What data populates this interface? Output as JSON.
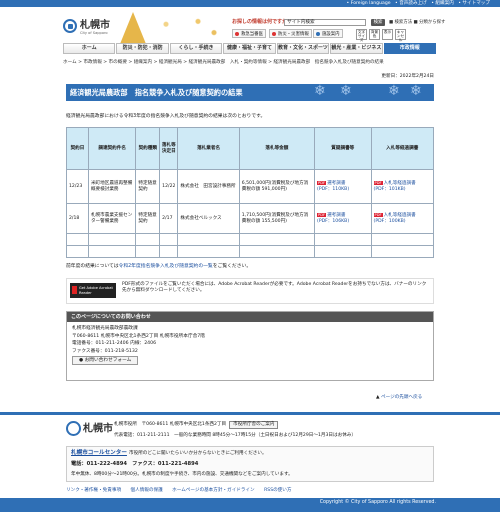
{
  "topbar": {
    "items": [
      "• Foreign language",
      "• 音声読み上げ",
      "• 組織案内",
      "• サイトマップ"
    ]
  },
  "header": {
    "city_name": "札幌市",
    "city_sub": "City of Sapporo",
    "search_label": "お探しの情報は何ですか。",
    "search_value": "サイト内検索",
    "search_button": "検索",
    "search_links": "■ 検索方法 ■ 分類から探す",
    "util_emergency": "救急当番医",
    "util_disaster": "防災・災害情報",
    "util_facility": "施設案内",
    "sq": [
      "文字サイズ",
      "背景色",
      "表示",
      "キャンセル"
    ]
  },
  "nav": [
    "ホーム",
    "防災・防犯・消防",
    "くらし・手続き",
    "健康・福祉・子育て",
    "教育・文化・スポーツ",
    "観光・産業・ビジネス",
    "市政情報"
  ],
  "breadcrumb": "ホーム > 市政情報 > 市の概要 > 組織案内 > 経済観光局 > 経済観光局農政部　入札・契約等情報 > 経済観光局農政部　指名競争入札及び随意契約の結果",
  "update": "更新日：2022年2月24日",
  "title": "経済観光局農政部　指名競争入札及び随意契約の結果",
  "intro": "経済観光局農政部における令和3年度の指名競争入札及び随意契約の結果は次のとおりです。",
  "table": {
    "headers": [
      "契約日",
      "調達契約件名",
      "契約種類",
      "落札等決定日",
      "落札業者名",
      "落札等金額",
      "質疑調書等",
      "入札等経過調書"
    ],
    "rows": [
      {
        "date": "12/23",
        "name": "米町地区農道再整備概要検討業務",
        "type": "特定随意契約",
        "decision": "12/22",
        "vendor": "株式会社　田宮設計事務所",
        "amount": "6,501,000円(消費税及び地方消費税の額 591,000円)",
        "qa": "選考調書",
        "qa_size": "(PDF：110KB)",
        "bid": "入札等経過調書",
        "bid_size": "(PDF：101KB)"
      },
      {
        "date": "2/18",
        "name": "札幌市農業支援センター警備業務",
        "type": "特定随意契約",
        "decision": "2/17",
        "vendor": "株式会社ベルックス",
        "amount": "1,710,500円(消費税及び地方消費税の額 155,500円)",
        "qa": "選考調書",
        "qa_size": "(PDF：106KB)",
        "bid": "入札等経過調書",
        "bid_size": "(PDF：100KB)"
      }
    ]
  },
  "note_prefix": "前年度の結果については",
  "note_link": "令和2年度指名競争入札及び随意契約の一覧",
  "note_suffix": "をご覧ください。",
  "adobe_badge": "Get Adobe Acrobat Reader",
  "adobe_text": "PDF形式のファイルをご覧いただく場合には、Adobe Acrobat Readerが必要です。Adobe Acrobat Readerをお持ちでない方は、バナーのリンク先から無料ダウンロードしてください。",
  "inquiry": {
    "heading": "このページについてのお問い合わせ",
    "dept": "札幌市経済観光局農政部農政課",
    "address": "〒060-8611 札幌市中央区北1条西2丁目 札幌市役所本庁舎7階",
    "phone": "電話番号：011-211-2406  内線：2406",
    "fax": "ファクス番号：011-218-5132",
    "form_button": "お問い合わせフォーム"
  },
  "pagetop": "ページの先頭へ戻る",
  "footer": {
    "city": "札幌市",
    "line1": "札幌市役所　〒060-8611 札幌市中央区北1条西2丁目",
    "map_button": "市役所庁舎のご案内",
    "line2": "代表電話：011-211-2111　一般的な業務時間 8時45分～17時15分（土日祝日および12月29日～1月3日はお休み）",
    "callcenter": "札幌市コールセンター",
    "callcenter_sub": "市役所のどこに聞いたらいいか分からないときにご利用ください。",
    "cc_phone": "電話：011-222-4894　ファクス：011-221-4894",
    "cc_hours": "年中無休、8時00分～21時00分。札幌市の制度や手続き、市内の施設、交通機関などをご案内しています。",
    "links": [
      "リンク・著作権・免責事項",
      "個人情報の保護",
      "ホームページの基本方針・ガイドライン",
      "RSSの使い方"
    ],
    "copyright": "Copyright © City of Sapporo All rights Reserved."
  }
}
